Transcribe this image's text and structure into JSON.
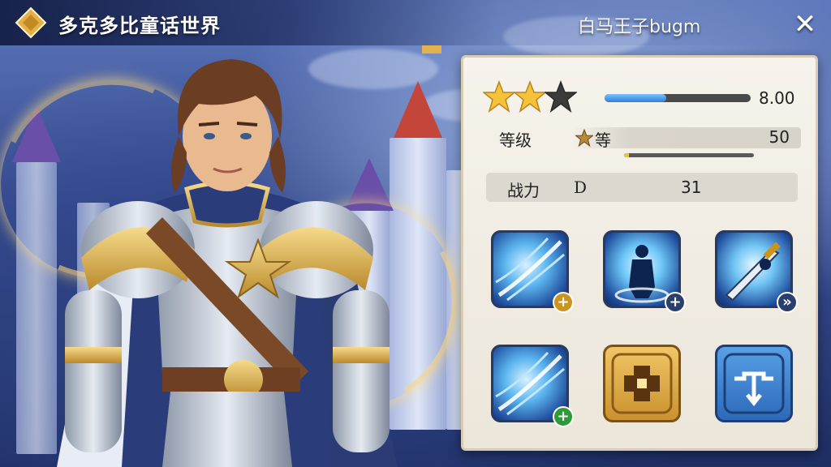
{
  "header": {
    "title": "多克多比童话世界",
    "subtitle": "白马王子bugm",
    "logo_icon": "gold-diamond-emblem-icon",
    "close_icon": "close-icon"
  },
  "character": {
    "portrait": "armored-knight-character"
  },
  "stats": {
    "stars": {
      "filled": 2,
      "total": 3
    },
    "rating_fraction": 0.42,
    "rating_value": "8.00",
    "level_label": "等级",
    "level_unit": "等",
    "level_value": "50",
    "level_exp_fraction": 0.04,
    "power_label": "战力",
    "power_grade": "D",
    "power_value": "31"
  },
  "skills": [
    {
      "icon": "ice-slash-skill-icon",
      "badge": "+",
      "badge_icon": "upgrade-plus-icon",
      "badge_color": "#c9951f"
    },
    {
      "icon": "knight-aura-skill-icon",
      "badge": "+",
      "badge_icon": "upgrade-plus-icon",
      "badge_color": "#2a3f6e"
    },
    {
      "icon": "sword-dash-skill-icon",
      "badge": "»",
      "badge_icon": "forward-arrow-icon",
      "badge_color": "#2a3f6e"
    },
    {
      "icon": "ice-slash-skill-icon",
      "badge": "+",
      "badge_icon": "upgrade-plus-icon",
      "badge_color": "#2f9a3a"
    },
    {
      "icon": "golden-cross-emblem-icon",
      "badge": "",
      "badge_icon": "",
      "badge_color": ""
    },
    {
      "icon": "blue-anchor-rune-icon",
      "badge": "",
      "badge_icon": "",
      "badge_color": ""
    }
  ],
  "colors": {
    "panel_bg": "#f3efe6",
    "accent_blue": "#2f7fd9",
    "gold": "#e3b14b"
  }
}
